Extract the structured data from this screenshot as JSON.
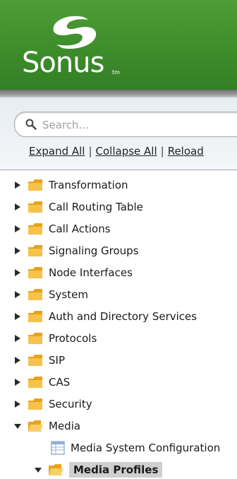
{
  "header": {
    "brand_name": "Sonus",
    "brand_mark": "tm",
    "accent_color": "#3d8d2b"
  },
  "search": {
    "placeholder": "Search..."
  },
  "actions": {
    "expand_all": "Expand All",
    "collapse_all": "Collapse All",
    "reload": "Reload",
    "separator": "|"
  },
  "tree": {
    "items": [
      {
        "label": "Transformation",
        "expanded": false,
        "icon": "folder-closed-icon"
      },
      {
        "label": "Call Routing Table",
        "expanded": false,
        "icon": "folder-closed-icon"
      },
      {
        "label": "Call Actions",
        "expanded": false,
        "icon": "folder-closed-icon"
      },
      {
        "label": "Signaling Groups",
        "expanded": false,
        "icon": "folder-closed-icon"
      },
      {
        "label": "Node Interfaces",
        "expanded": false,
        "icon": "folder-closed-icon"
      },
      {
        "label": "System",
        "expanded": false,
        "icon": "folder-closed-icon"
      },
      {
        "label": "Auth and Directory Services",
        "expanded": false,
        "icon": "folder-closed-icon"
      },
      {
        "label": "Protocols",
        "expanded": false,
        "icon": "folder-closed-icon"
      },
      {
        "label": "SIP",
        "expanded": false,
        "icon": "folder-closed-icon"
      },
      {
        "label": "CAS",
        "expanded": false,
        "icon": "folder-closed-icon"
      },
      {
        "label": "Security",
        "expanded": false,
        "icon": "folder-closed-icon"
      },
      {
        "label": "Media",
        "expanded": true,
        "icon": "folder-open-icon",
        "children": [
          {
            "label": "Media System Configuration",
            "icon": "table-icon"
          },
          {
            "label": "Media Profiles",
            "icon": "folder-open-icon",
            "expanded": true,
            "selected": true
          }
        ]
      }
    ]
  }
}
